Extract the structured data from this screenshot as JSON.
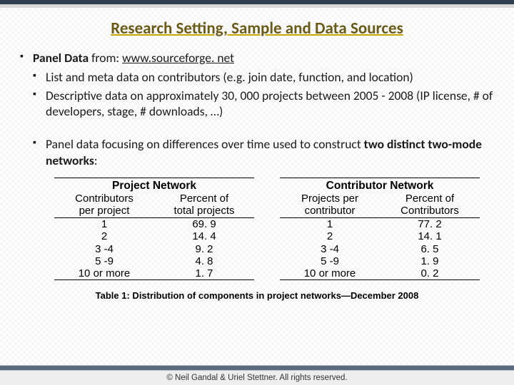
{
  "title": "Research Setting, Sample and Data Sources",
  "bullets": {
    "l1_prefix": "Panel Data",
    "l1_mid": " from: ",
    "l1_link": "www.sourceforge. net",
    "l2a": "List and meta data on contributors (e.g. join date, function, and location)",
    "l2b": "Descriptive data on approximately 30, 000 projects  between 2005 - 2008  (IP license, # of developers, stage, # downloads, …)",
    "l3_pre": "Panel data focusing on differences over time used to construct ",
    "l3_bold": "two distinct two-mode networks",
    "l3_post": ":"
  },
  "table_left": {
    "title": "Project Network",
    "h1a": "Contributors",
    "h1b": "per project",
    "h2a": "Percent of",
    "h2b": "total projects",
    "rows": [
      {
        "c1": "1",
        "c2": "69. 9"
      },
      {
        "c1": "2",
        "c2": "14. 4"
      },
      {
        "c1": "3 -4",
        "c2": "9. 2"
      },
      {
        "c1": "5 -9",
        "c2": "4. 8"
      },
      {
        "c1": "10 or more",
        "c2": "1. 7"
      }
    ]
  },
  "table_right": {
    "title": "Contributor Network",
    "h1a": "Projects per",
    "h1b": "contributor",
    "h2a": "Percent of",
    "h2b": "Contributors",
    "rows": [
      {
        "c1": "1",
        "c2": "77. 2"
      },
      {
        "c1": "2",
        "c2": "14. 1"
      },
      {
        "c1": "3 -4",
        "c2": "6. 5"
      },
      {
        "c1": "5 -9",
        "c2": "1. 9"
      },
      {
        "c1": "10 or more",
        "c2": "0. 2"
      }
    ]
  },
  "caption": "Table 1: Distribution of components in project networks—December 2008",
  "footer": "© Neil Gandal & Uriel Stettner. All rights reserved.",
  "chart_data": [
    {
      "type": "table",
      "title": "Project Network",
      "columns": [
        "Contributors per project",
        "Percent of total projects"
      ],
      "rows": [
        [
          "1",
          69.9
        ],
        [
          "2",
          14.4
        ],
        [
          "3-4",
          9.2
        ],
        [
          "5-9",
          4.8
        ],
        [
          "10 or more",
          1.7
        ]
      ]
    },
    {
      "type": "table",
      "title": "Contributor Network",
      "columns": [
        "Projects per contributor",
        "Percent of Contributors"
      ],
      "rows": [
        [
          "1",
          77.2
        ],
        [
          "2",
          14.1
        ],
        [
          "3-4",
          6.5
        ],
        [
          "5-9",
          1.9
        ],
        [
          "10 or more",
          0.2
        ]
      ]
    }
  ]
}
